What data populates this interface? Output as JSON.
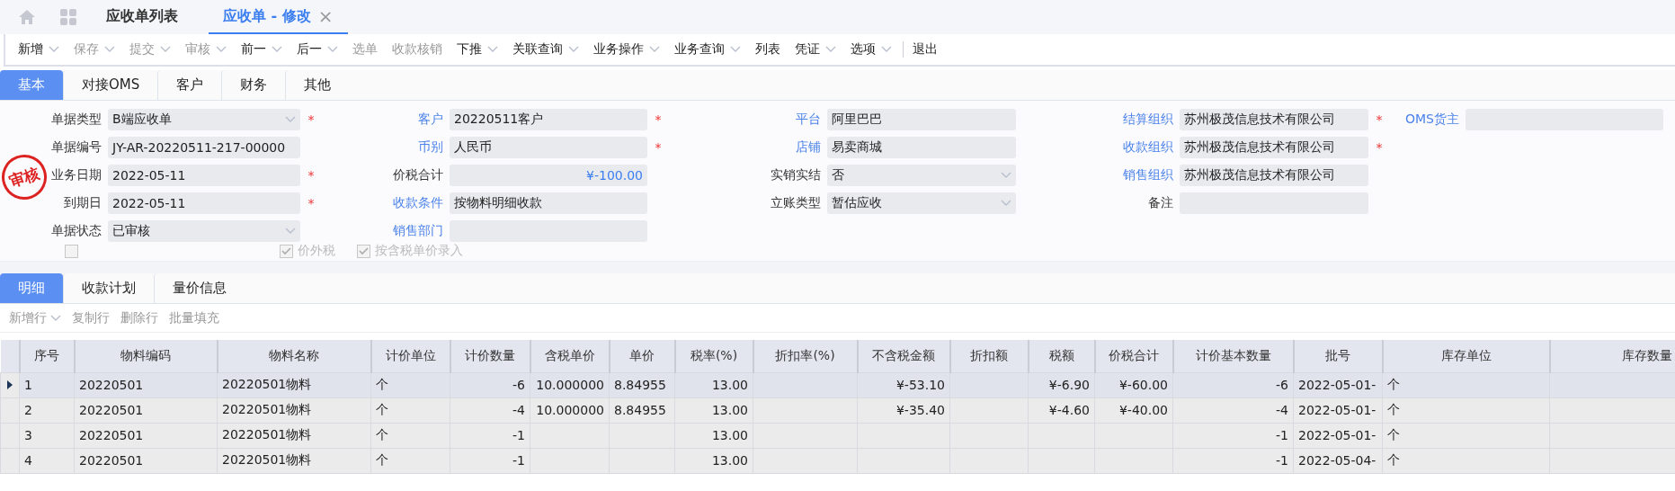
{
  "top_tabs": [
    {
      "label": "应收单列表",
      "selected": false,
      "closable": false
    },
    {
      "label": "应收单 - 修改",
      "selected": true,
      "closable": true
    }
  ],
  "close_glyph": "×",
  "toolbar": [
    {
      "label": "新增",
      "disabled": false,
      "caret": true
    },
    {
      "label": "保存",
      "disabled": true,
      "caret": true
    },
    {
      "label": "提交",
      "disabled": true,
      "caret": true
    },
    {
      "label": "审核",
      "disabled": true,
      "caret": true
    },
    {
      "label": "前一",
      "disabled": false,
      "caret": true
    },
    {
      "label": "后一",
      "disabled": false,
      "caret": true
    },
    {
      "label": "选单",
      "disabled": true,
      "caret": false
    },
    {
      "label": "收款核销",
      "disabled": true,
      "caret": false
    },
    {
      "label": "下推",
      "disabled": false,
      "caret": true
    },
    {
      "label": "关联查询",
      "disabled": false,
      "caret": true
    },
    {
      "label": "业务操作",
      "disabled": false,
      "caret": true
    },
    {
      "label": "业务查询",
      "disabled": false,
      "caret": true
    },
    {
      "label": "列表",
      "disabled": false,
      "caret": false
    },
    {
      "label": "凭证",
      "disabled": false,
      "caret": true
    },
    {
      "label": "选项",
      "disabled": false,
      "caret": true
    },
    {
      "label": "退出",
      "disabled": false,
      "caret": false,
      "separated": true
    }
  ],
  "form_tabs": [
    {
      "label": "基本",
      "selected": true
    },
    {
      "label": "对接OMS",
      "selected": false
    },
    {
      "label": "客户",
      "selected": false
    },
    {
      "label": "财务",
      "selected": false
    },
    {
      "label": "其他",
      "selected": false
    }
  ],
  "stamp": "审核",
  "required_mark": "*",
  "form_columns": [
    [
      {
        "label": "单据类型",
        "value": "B端应收单",
        "kind": "select",
        "link": false,
        "required": true
      },
      {
        "label": "单据编号",
        "value": "JY-AR-20220511-217-00000",
        "kind": "text",
        "link": false,
        "required": false
      },
      {
        "label": "业务日期",
        "value": "2022-05-11",
        "kind": "text",
        "link": false,
        "required": true
      },
      {
        "label": "到期日",
        "value": "2022-05-11",
        "kind": "text",
        "link": false,
        "required": true
      },
      {
        "label": "单据状态",
        "value": "已审核",
        "kind": "select",
        "link": false,
        "required": false
      }
    ],
    [
      {
        "label": "客户",
        "value": "20220511客户",
        "kind": "text",
        "link": true,
        "required": true
      },
      {
        "label": "币别",
        "value": "人民币",
        "kind": "text",
        "link": true,
        "required": true
      },
      {
        "label": "价税合计",
        "value": "¥-100.00",
        "kind": "amount",
        "link": false,
        "required": false
      },
      {
        "label": "收款条件",
        "value": "按物料明细收款",
        "kind": "text",
        "link": true,
        "required": false
      },
      {
        "label": "销售部门",
        "kind": "text",
        "link": true,
        "required": false
      }
    ],
    [
      {
        "label": "平台",
        "value": "阿里巴巴",
        "kind": "text",
        "link": true,
        "required": false
      },
      {
        "label": "店铺",
        "value": "易卖商城",
        "kind": "text",
        "link": true,
        "required": false
      },
      {
        "label": "实销实结",
        "value": "否",
        "kind": "select",
        "link": false,
        "required": false
      },
      {
        "label": "立账类型",
        "value": "暂估应收",
        "kind": "select",
        "link": false,
        "required": false
      }
    ],
    [
      {
        "label": "结算组织",
        "value": "苏州极茂信息技术有限公司",
        "kind": "text",
        "link": true,
        "required": true
      },
      {
        "label": "收款组织",
        "value": "苏州极茂信息技术有限公司",
        "kind": "text",
        "link": true,
        "required": true
      },
      {
        "label": "销售组织",
        "value": "苏州极茂信息技术有限公司",
        "kind": "text",
        "link": true,
        "required": false
      },
      {
        "label": "备注",
        "kind": "text",
        "link": false,
        "required": false
      }
    ],
    [
      {
        "label": "OMS货主",
        "kind": "text",
        "link": true,
        "required": false
      }
    ]
  ],
  "checkboxes": [
    {
      "checked": false,
      "disabled": true
    },
    {
      "label": "价外税",
      "checked": true,
      "disabled": true
    },
    {
      "label": "按含税单价录入",
      "checked": true,
      "disabled": true
    }
  ],
  "detail_tabs": [
    {
      "label": "明细",
      "selected": true
    },
    {
      "label": "收款计划",
      "selected": false
    },
    {
      "label": "量价信息",
      "selected": false
    }
  ],
  "detail_toolbar": [
    {
      "label": "新增行",
      "caret": true
    },
    {
      "label": "复制行",
      "caret": false
    },
    {
      "label": "删除行",
      "caret": false
    },
    {
      "label": "批量填充",
      "caret": false
    }
  ],
  "table": {
    "columns": [
      {
        "label": "序号"
      },
      {
        "label": "物料编码"
      },
      {
        "label": "物料名称"
      },
      {
        "label": "计价单位"
      },
      {
        "label": "计价数量"
      },
      {
        "label": "含税单价"
      },
      {
        "label": "单价"
      },
      {
        "label": "税率(%)"
      },
      {
        "label": "折扣率(%)"
      },
      {
        "label": "不含税金额"
      },
      {
        "label": "折扣额"
      },
      {
        "label": "税额"
      },
      {
        "label": "价税合计"
      },
      {
        "label": "计价基本数量"
      },
      {
        "label": "批号"
      },
      {
        "label": "库存单位"
      },
      {
        "label": "库存数量"
      }
    ],
    "rows": [
      {
        "selected": true,
        "cells": [
          "1",
          "20220501",
          "20220501物料",
          "个",
          "-6",
          "10.000000",
          "8.84955",
          "13.00",
          "",
          "¥-53.10",
          "",
          "¥-6.90",
          "¥-60.00",
          "-6",
          "2022-05-01-",
          "个",
          ""
        ]
      },
      {
        "selected": false,
        "cells": [
          "2",
          "20220501",
          "20220501物料",
          "个",
          "-4",
          "10.000000",
          "8.84955",
          "13.00",
          "",
          "¥-35.40",
          "",
          "¥-4.60",
          "¥-40.00",
          "-4",
          "2022-05-01-",
          "个",
          ""
        ]
      },
      {
        "selected": false,
        "cells": [
          "3",
          "20220501",
          "20220501物料",
          "个",
          "-1",
          "",
          "",
          "13.00",
          "",
          "",
          "",
          "",
          "",
          "-1",
          "2022-05-01-",
          "个",
          ""
        ]
      },
      {
        "selected": false,
        "cells": [
          "4",
          "20220501",
          "20220501物料",
          "个",
          "-1",
          "",
          "",
          "13.00",
          "",
          "",
          "",
          "",
          "",
          "-1",
          "2022-05-04-",
          "个",
          ""
        ]
      }
    ]
  }
}
